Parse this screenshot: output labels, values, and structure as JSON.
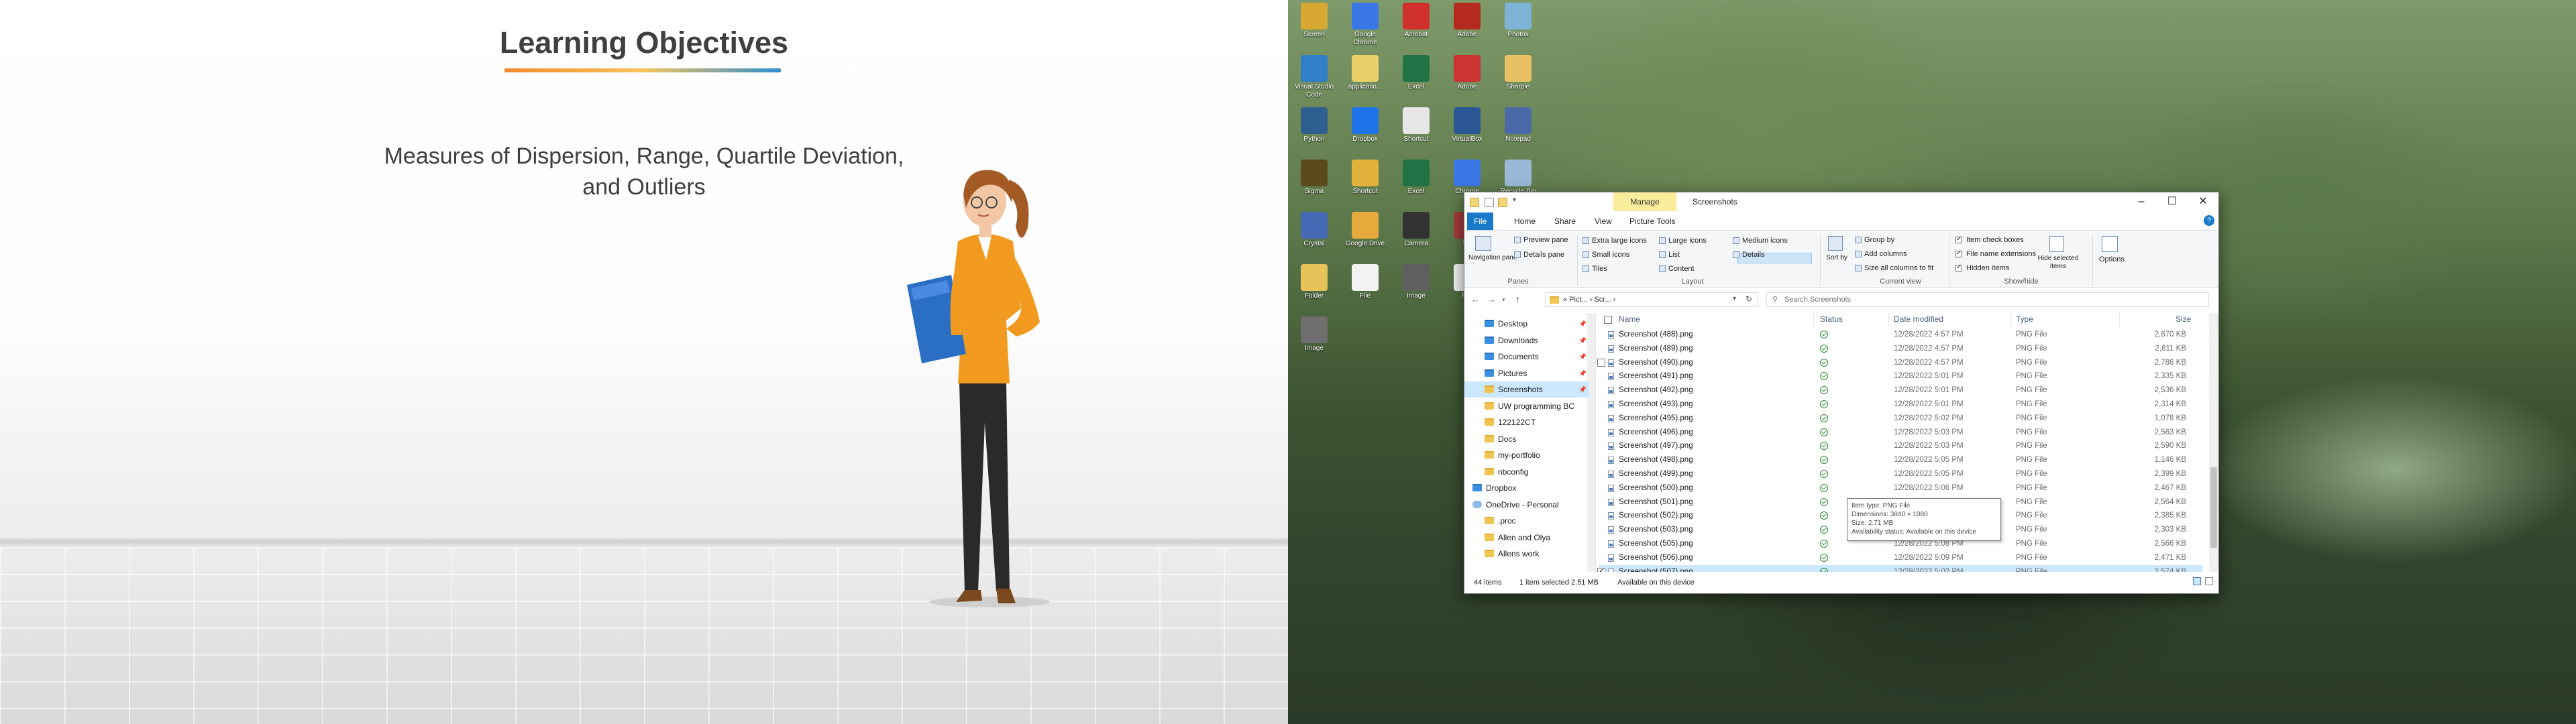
{
  "slide": {
    "title": "Learning Objectives",
    "subtitle_line1": "Measures of Dispersion, Range, Quartile Deviation,",
    "subtitle_line2": "and Outliers",
    "colors": {
      "title": "#3f3f3f",
      "underline_start": "#f08a2f",
      "underline_end": "#2f8fd0",
      "shirt": "#f29a1f",
      "folder": "#2b6fc4"
    }
  },
  "desktop_icons": [
    {
      "label": "Screen",
      "color": "#d7a832",
      "icon": "app-icon"
    },
    {
      "label": "Google Chrome",
      "color": "#3b78e7",
      "icon": "chrome-icon"
    },
    {
      "label": "Acrobat",
      "color": "#d0312d",
      "icon": "acrobat-icon"
    },
    {
      "label": "Adobe",
      "color": "#b5291f",
      "icon": "adobe-icon"
    },
    {
      "label": "Photos",
      "color": "#7fb3d5",
      "icon": "photos-icon"
    },
    {
      "label": "Visual Studio Code",
      "color": "#2f80c9",
      "icon": "vscode-icon"
    },
    {
      "label": "applicatio...",
      "color": "#e9d06a",
      "icon": "file-icon"
    },
    {
      "label": "Excel",
      "color": "#217346",
      "icon": "excel-icon"
    },
    {
      "label": "Adobe",
      "color": "#c33",
      "icon": "adobe-icon"
    },
    {
      "label": "Sharpie",
      "color": "#e7c164",
      "icon": "folder-icon"
    },
    {
      "label": "Python",
      "color": "#2f5f8f",
      "icon": "python-icon"
    },
    {
      "label": "Dropbox",
      "color": "#1e73e8",
      "icon": "dropbox-icon"
    },
    {
      "label": "Shortcut",
      "color": "#e6e6e6",
      "icon": "file-icon"
    },
    {
      "label": "VirtualBox",
      "color": "#2b5797",
      "icon": "virtualbox-icon"
    },
    {
      "label": "Notepad",
      "color": "#4a6aa7",
      "icon": "notepad-icon"
    },
    {
      "label": "Sigma",
      "color": "#5c4a1a",
      "icon": "sigma-icon"
    },
    {
      "label": "Shortcut",
      "color": "#e3b23c",
      "icon": "app-icon"
    },
    {
      "label": "Excel",
      "color": "#217346",
      "icon": "excel-icon"
    },
    {
      "label": "Chrome",
      "color": "#3b78e7",
      "icon": "chrome-icon"
    },
    {
      "label": "Recycle Bin",
      "color": "#9ab8d8",
      "icon": "recycle-bin-icon"
    },
    {
      "label": "Crystal",
      "color": "#4669b3",
      "icon": "app-icon"
    },
    {
      "label": "Google Drive",
      "color": "#e6a93c",
      "icon": "drive-icon"
    },
    {
      "label": "Camera",
      "color": "#333333",
      "icon": "camera-icon"
    },
    {
      "label": "Tile",
      "color": "#a33c3c",
      "icon": "app-icon"
    },
    {
      "label": "Folder",
      "color": "#e8c35a",
      "icon": "folder-icon"
    },
    {
      "label": "Folder",
      "color": "#e8c35a",
      "icon": "folder-icon"
    },
    {
      "label": "File",
      "color": "#f2f2f2",
      "icon": "file-icon"
    },
    {
      "label": "Image",
      "color": "#5f5f5f",
      "icon": "image-icon"
    },
    {
      "label": "File",
      "color": "#f2f2f2",
      "icon": "file-icon"
    },
    {
      "label": "Image",
      "color": "#4f6f4f",
      "icon": "image-icon"
    },
    {
      "label": "Image",
      "color": "#6f6f6f",
      "icon": "image-icon"
    }
  ],
  "explorer": {
    "context_tab": "Manage",
    "title": "Screenshots",
    "tabs": [
      "File",
      "Home",
      "Share",
      "View",
      "Picture Tools"
    ],
    "help": "?",
    "ribbon": {
      "panes": {
        "navigation_pane": "Navigation pane",
        "preview_pane": "Preview pane",
        "details_pane": "Details pane",
        "label": "Panes"
      },
      "layout": {
        "items": [
          "Extra large icons",
          "Large icons",
          "Medium icons",
          "Small icons",
          "List",
          "Details",
          "Tiles",
          "Content"
        ],
        "label": "Layout",
        "selected": "Details"
      },
      "current_view": {
        "sort_by": "Sort by",
        "group_by": "Group by",
        "add_columns": "Add columns",
        "size_all": "Size all columns to fit",
        "label": "Current view"
      },
      "show_hide": {
        "item_check_boxes": "Item check boxes",
        "file_name_extensions": "File name extensions",
        "hidden_items": "Hidden items",
        "hide_selected": "Hide selected items",
        "label": "Show/hide"
      },
      "options": "Options"
    },
    "breadcrumb": "« Pict... › Scr... ›",
    "search_placeholder": "Search Screenshots",
    "nav_items": [
      {
        "label": "Desktop",
        "icon": "blue",
        "pin": true
      },
      {
        "label": "Downloads",
        "icon": "blue",
        "pin": true
      },
      {
        "label": "Documents",
        "icon": "blue",
        "pin": true
      },
      {
        "label": "Pictures",
        "icon": "blue",
        "pin": true
      },
      {
        "label": "Screenshots",
        "icon": "folder",
        "pin": true,
        "selected": true
      },
      {
        "label": "UW programming BC",
        "icon": "folder",
        "pin": false
      },
      {
        "label": "122122CT",
        "icon": "folder",
        "pin": false
      },
      {
        "label": "Docs",
        "icon": "folder",
        "pin": false
      },
      {
        "label": "my-portfolio",
        "icon": "folder",
        "pin": false
      },
      {
        "label": "nbconfig",
        "icon": "folder",
        "pin": false
      },
      {
        "label": "Dropbox",
        "icon": "blue",
        "pin": false
      },
      {
        "label": "OneDrive - Personal",
        "icon": "cloud",
        "pin": false
      },
      {
        "label": ".proc",
        "icon": "folder",
        "pin": false
      },
      {
        "label": "Allen and Olya",
        "icon": "folder",
        "pin": false
      },
      {
        "label": "Allens work",
        "icon": "folder",
        "pin": false
      }
    ],
    "columns": {
      "name": "Name",
      "status": "Status",
      "date": "Date modified",
      "type": "Type",
      "size": "Size"
    },
    "files": [
      {
        "name": "Screenshot (488).png",
        "date": "12/28/2022 4:57 PM",
        "type": "PNG File",
        "size": "2,670 KB"
      },
      {
        "name": "Screenshot (489).png",
        "date": "12/28/2022 4:57 PM",
        "type": "PNG File",
        "size": "2,811 KB"
      },
      {
        "name": "Screenshot (490).png",
        "date": "12/28/2022 4:57 PM",
        "type": "PNG File",
        "size": "2,786 KB"
      },
      {
        "name": "Screenshot (491).png",
        "date": "12/28/2022 5:01 PM",
        "type": "PNG File",
        "size": "2,335 KB"
      },
      {
        "name": "Screenshot (492).png",
        "date": "12/28/2022 5:01 PM",
        "type": "PNG File",
        "size": "2,536 KB"
      },
      {
        "name": "Screenshot (493).png",
        "date": "12/28/2022 5:01 PM",
        "type": "PNG File",
        "size": "2,314 KB"
      },
      {
        "name": "Screenshot (495).png",
        "date": "12/28/2022 5:02 PM",
        "type": "PNG File",
        "size": "1,078 KB"
      },
      {
        "name": "Screenshot (496).png",
        "date": "12/28/2022 5:03 PM",
        "type": "PNG File",
        "size": "2,563 KB"
      },
      {
        "name": "Screenshot (497).png",
        "date": "12/28/2022 5:03 PM",
        "type": "PNG File",
        "size": "2,590 KB"
      },
      {
        "name": "Screenshot (498).png",
        "date": "12/28/2022 5:05 PM",
        "type": "PNG File",
        "size": "1,146 KB"
      },
      {
        "name": "Screenshot (499).png",
        "date": "12/28/2022 5:05 PM",
        "type": "PNG File",
        "size": "2,399 KB"
      },
      {
        "name": "Screenshot (500).png",
        "date": "12/28/2022 5:06 PM",
        "type": "PNG File",
        "size": "2,467 KB"
      },
      {
        "name": "Screenshot (501).png",
        "date": "12/28/2022 5:06 PM",
        "type": "PNG File",
        "size": "2,564 KB"
      },
      {
        "name": "Screenshot (502).png",
        "date": "12/28/2022 5:06 PM",
        "type": "PNG File",
        "size": "2,385 KB"
      },
      {
        "name": "Screenshot (503).png",
        "date": "12/28/2022 5:07 PM",
        "type": "PNG File",
        "size": "2,303 KB"
      },
      {
        "name": "Screenshot (505).png",
        "date": "12/28/2022 5:08 PM",
        "type": "PNG File",
        "size": "2,566 KB"
      },
      {
        "name": "Screenshot (506).png",
        "date": "12/28/2022 5:09 PM",
        "type": "PNG File",
        "size": "2,471 KB"
      },
      {
        "name": "Screenshot (507).png",
        "date": "12/28/2022 5:02 PM",
        "type": "PNG File",
        "size": "2,574 KB",
        "selected": true
      }
    ],
    "tooltip": {
      "line1": "Item type: PNG File",
      "line2": "Dimensions: 3840 × 1080",
      "line3": "Size: 2.71 MB",
      "line4": "Availability status: Available on this device"
    },
    "status": {
      "items": "44 items",
      "selected": "1 item selected  2.51 MB",
      "availability": "Available on this device"
    }
  }
}
